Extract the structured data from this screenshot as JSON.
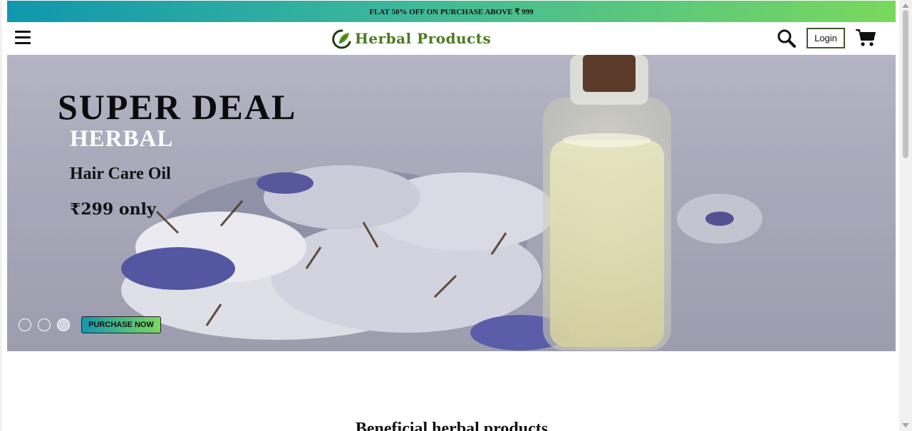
{
  "promo": {
    "text": "FLAT 50% OFF ON PURCHASE ABOVE ₹ 999"
  },
  "header": {
    "logo_text": "Herbal Products",
    "login_label": "Login",
    "icons": [
      "menu-icon",
      "leaf-logo-icon",
      "search-icon",
      "cart-icon"
    ]
  },
  "hero": {
    "title": "SUPER DEAL",
    "subtitle": "HERBAL",
    "product": "Hair Care Oil",
    "price": "₹299 only",
    "cta_label": "PURCHASE NOW",
    "slides_count": 3,
    "active_slide": 3
  },
  "section": {
    "title": "Beneficial herbal products"
  },
  "colors": {
    "accent_start": "#0f97ae",
    "accent_end": "#79d85c",
    "logo_green": "#4b7a1f",
    "login_border": "#3e5a28"
  }
}
